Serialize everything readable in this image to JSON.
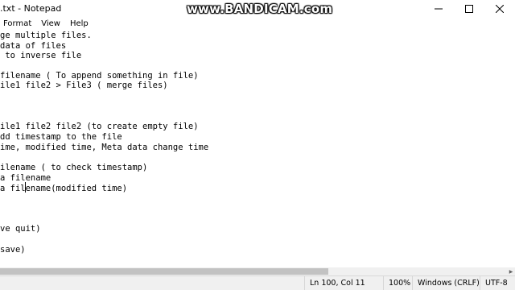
{
  "window": {
    "title": ".txt - Notepad",
    "watermark": "www.BANDICAM.com"
  },
  "menu": {
    "items": [
      "Format",
      "View",
      "Help"
    ]
  },
  "editor": {
    "lines": [
      "ge multiple files.",
      "data of files",
      " to inverse file",
      "",
      "filename ( To append something in file)",
      "ile1 file2 > File3 ( merge files)",
      "",
      "",
      "",
      "ile1 file2 file2 (to create empty file)",
      "dd timestamp to the file",
      "ime, modified time, Meta data change time",
      "",
      "ilename ( to check timestamp)",
      "a filename",
      "a filename(modified time)",
      "",
      "",
      "",
      "ve quit)",
      "",
      "save)"
    ]
  },
  "status": {
    "position": "Ln 100, Col 11",
    "zoom": "100%",
    "line_ending": "Windows (CRLF)",
    "encoding": "UTF-8"
  }
}
